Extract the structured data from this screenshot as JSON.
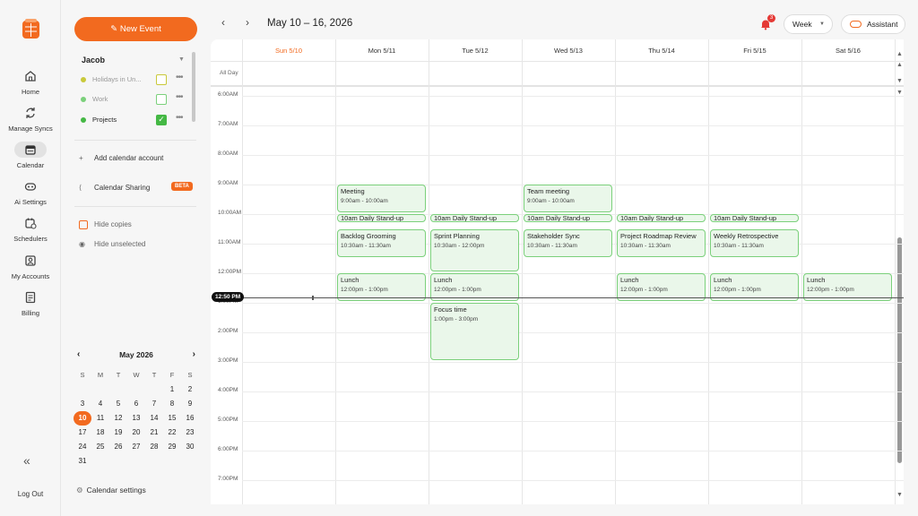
{
  "colors": {
    "accent": "#f26a1f",
    "event_fill": "#eaf7ea",
    "event_border": "#7bd07b"
  },
  "rail": {
    "items": [
      {
        "label": "Home",
        "icon": "home-icon"
      },
      {
        "label": "Manage Syncs",
        "icon": "sync-icon"
      },
      {
        "label": "Calendar",
        "icon": "calendar-icon"
      },
      {
        "label": "Ai Settings",
        "icon": "ai-icon"
      },
      {
        "label": "Schedulers",
        "icon": "scheduler-icon"
      },
      {
        "label": "My Accounts",
        "icon": "account-icon"
      },
      {
        "label": "Billing",
        "icon": "billing-icon"
      }
    ],
    "logout": "Log Out"
  },
  "sidebar": {
    "new_event": "New Event",
    "account": "Jacob",
    "calendars": [
      {
        "label": "Holidays in Un...",
        "color": "#c9c93a",
        "checked": false
      },
      {
        "label": "Work",
        "color": "#7bd07b",
        "checked": false
      },
      {
        "label": "Projects",
        "color": "#44b844",
        "checked": true
      }
    ],
    "add_account": "Add calendar account",
    "sharing": "Calendar Sharing",
    "beta": "BETA",
    "hide_copies": "Hide copies",
    "hide_unselected": "Hide unselected",
    "settings": "Calendar settings"
  },
  "mini_cal": {
    "month": "May 2026",
    "dow": [
      "S",
      "M",
      "T",
      "W",
      "T",
      "F",
      "S"
    ],
    "selected": "10",
    "weeks": [
      [
        "",
        "",
        "",
        "",
        "",
        "1",
        "2"
      ],
      [
        "3",
        "4",
        "5",
        "6",
        "7",
        "8",
        "9"
      ],
      [
        "10",
        "11",
        "12",
        "13",
        "14",
        "15",
        "16"
      ],
      [
        "17",
        "18",
        "19",
        "20",
        "21",
        "22",
        "23"
      ],
      [
        "24",
        "25",
        "26",
        "27",
        "28",
        "29",
        "30"
      ],
      [
        "31",
        "",
        "",
        "",
        "",
        "",
        ""
      ]
    ]
  },
  "header": {
    "range": "May 10 – 16, 2026",
    "notifications": "3",
    "view": "Week",
    "assistant": "Assistant"
  },
  "days": [
    "Sun 5/10",
    "Mon 5/11",
    "Tue 5/12",
    "Wed 5/13",
    "Thu 5/14",
    "Fri 5/15",
    "Sat 5/16"
  ],
  "all_day_label": "All Day",
  "hours": [
    "6:00AM",
    "7:00AM",
    "8:00AM",
    "9:00AM",
    "10:00AM",
    "11:00AM",
    "12:00PM",
    "1:00PM",
    "2:00PM",
    "3:00PM",
    "4:00PM",
    "5:00PM",
    "6:00PM",
    "7:00PM"
  ],
  "now_label": "12:50 PM",
  "events": [
    {
      "day": 1,
      "title": "Meeting",
      "time": "9:00am - 10:00am",
      "start": 9,
      "end": 10
    },
    {
      "day": 3,
      "title": "Team meeting",
      "time": "9:00am - 10:00am",
      "start": 9,
      "end": 10
    },
    {
      "day": 1,
      "title": "10am Daily Stand-up",
      "time": "",
      "start": 10,
      "end": 10.25
    },
    {
      "day": 2,
      "title": "10am Daily Stand-up",
      "time": "",
      "start": 10,
      "end": 10.25
    },
    {
      "day": 3,
      "title": "10am Daily Stand-up",
      "time": "",
      "start": 10,
      "end": 10.25
    },
    {
      "day": 4,
      "title": "10am Daily Stand-up",
      "time": "",
      "start": 10,
      "end": 10.25
    },
    {
      "day": 5,
      "title": "10am Daily Stand-up",
      "time": "",
      "start": 10,
      "end": 10.25
    },
    {
      "day": 1,
      "title": "Backlog Grooming",
      "time": "10:30am - 11:30am",
      "start": 10.5,
      "end": 11.5
    },
    {
      "day": 2,
      "title": "Sprint Planning",
      "time": "10:30am - 12:00pm",
      "start": 10.5,
      "end": 12
    },
    {
      "day": 3,
      "title": "Stakeholder Sync",
      "time": "10:30am - 11:30am",
      "start": 10.5,
      "end": 11.5
    },
    {
      "day": 4,
      "title": "Project Roadmap Review",
      "time": "10:30am - 11:30am",
      "start": 10.5,
      "end": 11.5
    },
    {
      "day": 5,
      "title": "Weekly Retrospective",
      "time": "10:30am - 11:30am",
      "start": 10.5,
      "end": 11.5
    },
    {
      "day": 1,
      "title": "Lunch",
      "time": "12:00pm - 1:00pm",
      "start": 12,
      "end": 13
    },
    {
      "day": 2,
      "title": "Lunch",
      "time": "12:00pm - 1:00pm",
      "start": 12,
      "end": 13
    },
    {
      "day": 4,
      "title": "Lunch",
      "time": "12:00pm - 1:00pm",
      "start": 12,
      "end": 13
    },
    {
      "day": 5,
      "title": "Lunch",
      "time": "12:00pm - 1:00pm",
      "start": 12,
      "end": 13
    },
    {
      "day": 6,
      "title": "Lunch",
      "time": "12:00pm - 1:00pm",
      "start": 12,
      "end": 13
    },
    {
      "day": 2,
      "title": "Focus time",
      "time": "1:00pm - 3:00pm",
      "start": 13,
      "end": 15
    }
  ]
}
